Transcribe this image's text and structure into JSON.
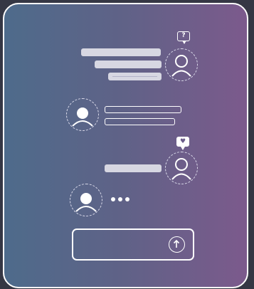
{
  "badges": {
    "question_mark": "?",
    "heart_symbol": "♥"
  },
  "messages": [
    {
      "sender": "right",
      "bar_count": 3,
      "badge_icon": "question-icon"
    },
    {
      "sender": "left",
      "bar_count": 2
    },
    {
      "sender": "right",
      "bar_count": 1,
      "badge_icon": "heart-icon"
    },
    {
      "sender": "left",
      "typing_indicator": true
    }
  ],
  "colors": {
    "gradient_left": "#4e6b8b",
    "gradient_right": "#7c5a8c",
    "bar_fill": "#d7d7e2",
    "stroke": "#ffffff"
  },
  "icons": {
    "avatar": "user-avatar-icon",
    "send": "arrow-up-circle-icon"
  }
}
